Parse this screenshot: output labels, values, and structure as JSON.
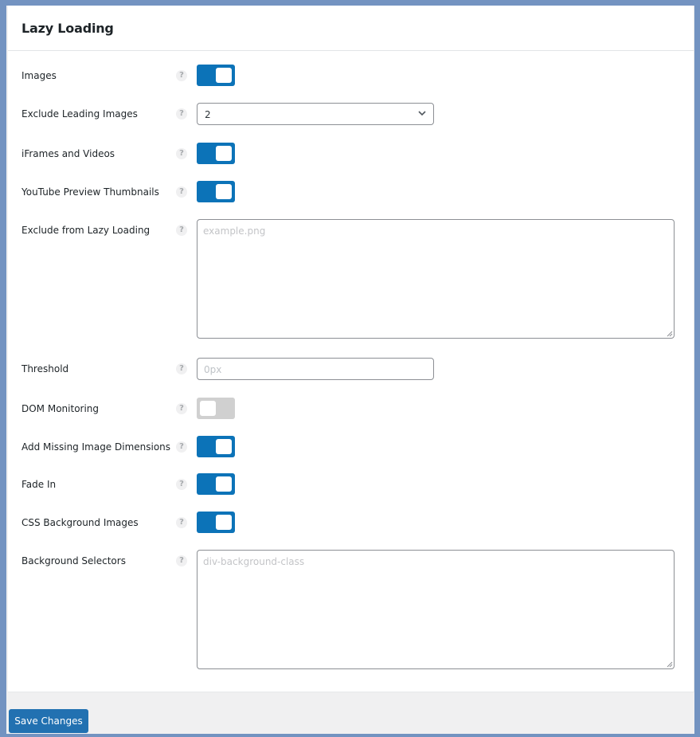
{
  "section": {
    "title": "Lazy Loading"
  },
  "help_glyph": "?",
  "settings": {
    "images": {
      "label": "Images",
      "enabled": true
    },
    "exclude_leading_images": {
      "label": "Exclude Leading Images",
      "value": "2"
    },
    "iframes_videos": {
      "label": "iFrames and Videos",
      "enabled": true
    },
    "youtube_thumbnails": {
      "label": "YouTube Preview Thumbnails",
      "enabled": true
    },
    "exclude_from_lazy": {
      "label": "Exclude from Lazy Loading",
      "value": "",
      "placeholder": "example.png"
    },
    "threshold": {
      "label": "Threshold",
      "value": "",
      "placeholder": "0px"
    },
    "dom_monitoring": {
      "label": "DOM Monitoring",
      "enabled": false
    },
    "missing_dimensions": {
      "label": "Add Missing Image Dimensions",
      "enabled": true
    },
    "fade_in": {
      "label": "Fade In",
      "enabled": true
    },
    "css_background_images": {
      "label": "CSS Background Images",
      "enabled": true
    },
    "background_selectors": {
      "label": "Background Selectors",
      "value": "",
      "placeholder": "div-background-class"
    }
  },
  "footer": {
    "save_label": "Save Changes"
  },
  "colors": {
    "accent": "#0c73b8",
    "button": "#2271b1",
    "toggle_off": "#d0d0d0",
    "frame": "#7393c1"
  }
}
